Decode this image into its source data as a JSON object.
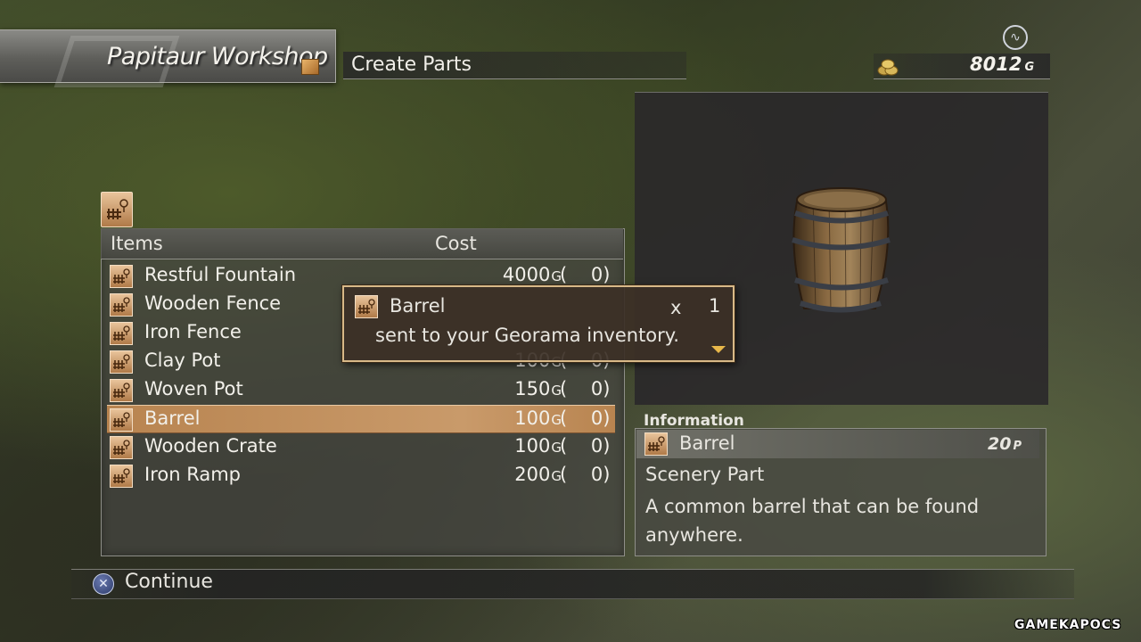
{
  "header": {
    "workshop_name": "Papitaur Workshop",
    "section_title": "Create Parts",
    "gold_amount": "8012",
    "gold_unit": "G"
  },
  "list": {
    "col_items": "Items",
    "col_cost": "Cost",
    "price_unit": "G",
    "rows": [
      {
        "name": "Restful Fountain",
        "price": "4000",
        "owned": "(    0)"
      },
      {
        "name": "Wooden Fence",
        "price": "",
        "owned": ""
      },
      {
        "name": "Iron Fence",
        "price": "",
        "owned": ""
      },
      {
        "name": "Clay Pot",
        "price": "100",
        "owned": "(    0)"
      },
      {
        "name": "Woven Pot",
        "price": "150",
        "owned": "(    0)"
      },
      {
        "name": "Barrel",
        "price": "100",
        "owned": "(    0)"
      },
      {
        "name": "Wooden Crate",
        "price": "100",
        "owned": "(    0)"
      },
      {
        "name": "Iron Ramp",
        "price": "200",
        "owned": "(    0)"
      }
    ],
    "selected_index": 5
  },
  "popup": {
    "item_name": "Barrel",
    "multiply": "x",
    "quantity": "1",
    "message": "sent to your Georama inventory."
  },
  "info": {
    "label": "Information",
    "name": "Barrel",
    "points": "20",
    "points_unit": "P",
    "type": "Scenery Part",
    "description": "A common barrel that can be found anywhere."
  },
  "footer": {
    "continue_label": "Continue",
    "continue_button_glyph": "✕"
  },
  "icons": {
    "part": "scenery-part-icon",
    "top_right": "network-status-icon"
  },
  "watermark": "GAMEKAPOCS"
}
